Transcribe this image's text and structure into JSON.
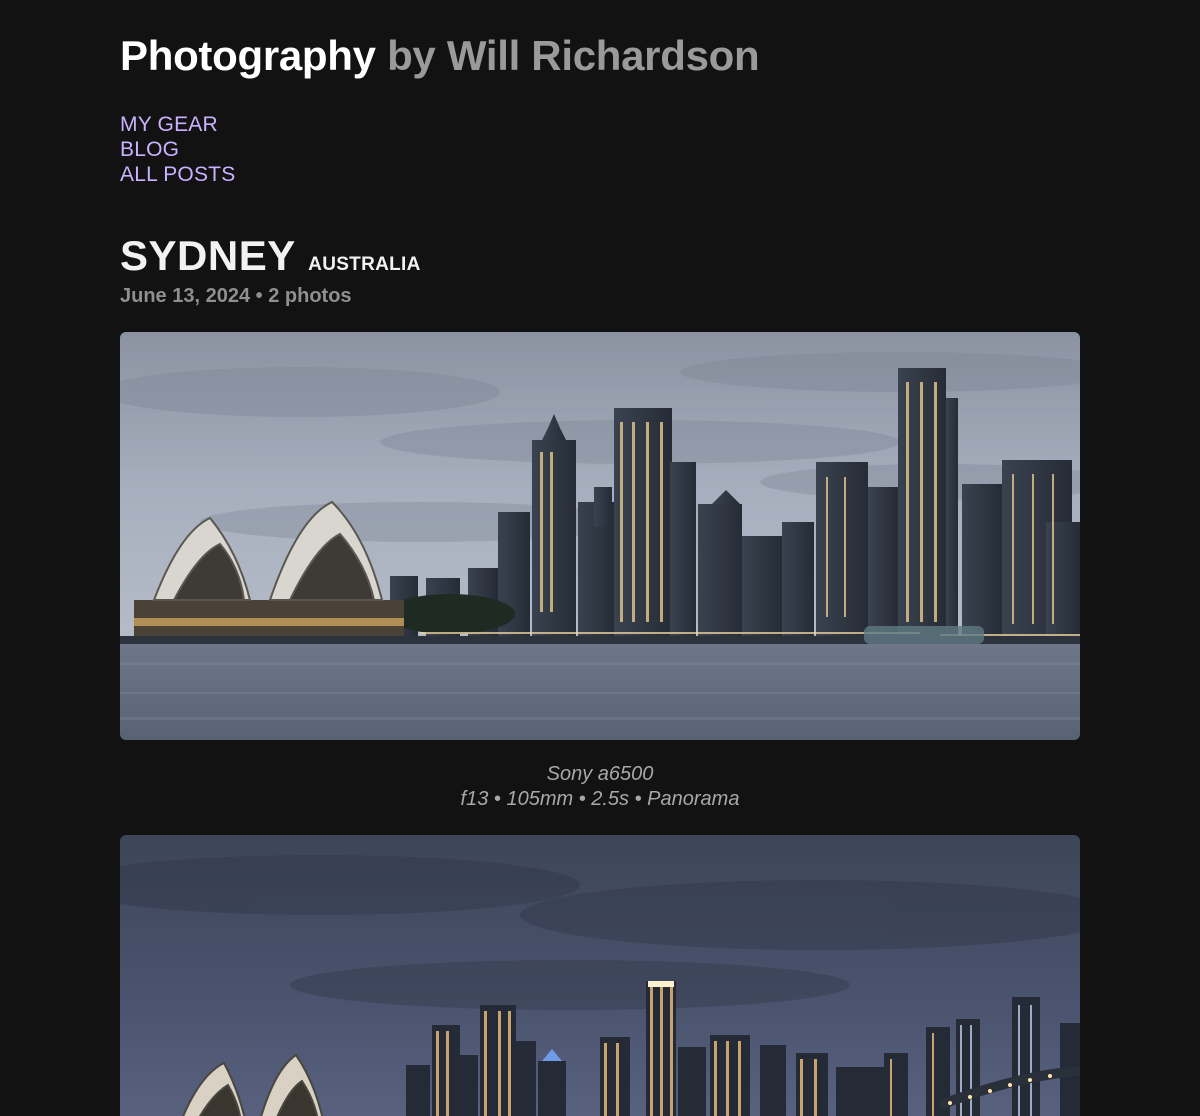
{
  "header": {
    "title_main": "Photography",
    "title_by": "by Will Richardson"
  },
  "nav": {
    "items": [
      {
        "label": "MY GEAR"
      },
      {
        "label": "BLOG"
      },
      {
        "label": "ALL POSTS"
      }
    ]
  },
  "post": {
    "title": "SYDNEY",
    "country": "AUSTRALIA",
    "meta": "June 13, 2024 • 2 photos"
  },
  "photos": [
    {
      "camera": "Sony a6500",
      "settings": "f13 • 105mm • 2.5s • Panorama"
    }
  ],
  "colors": {
    "background": "#121212",
    "link": "#c9b2ff",
    "muted": "#9a9a9a"
  }
}
